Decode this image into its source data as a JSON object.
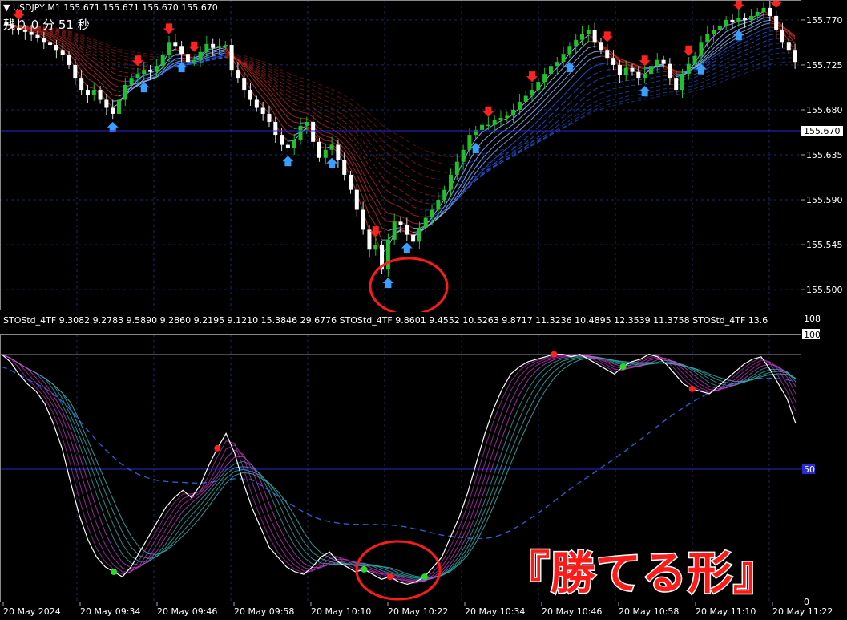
{
  "header": {
    "symbol_line": "USDJPY,M1  155.671 155.671 155.670 155.670",
    "countdown": "残り 0 分 51 秒",
    "indicator_line": "STOStd_4TF 9.3082 9.2783 9.5890 9.2860 9.2195 9.1210 15.3846 29.6776  STOStd_4TF 9.8601 9.4552 10.5263 9.8717 11.3236 10.4895 12.3539 11.3758  STOStd_4TF 13.6"
  },
  "price_axis": {
    "ticks": [
      "155.770",
      "155.725",
      "155.680",
      "155.635",
      "155.590",
      "155.545",
      "155.500"
    ],
    "current_price": "155.670"
  },
  "osc_axis": {
    "ticks": [
      "108",
      "100",
      "50",
      "0"
    ]
  },
  "time_axis": {
    "labels": [
      "20 May 2024",
      "20 May 09:34",
      "20 May 09:46",
      "20 May 09:58",
      "20 May 10:10",
      "20 May 10:22",
      "20 May 10:34",
      "20 May 10:46",
      "20 May 10:58",
      "20 May 11:10",
      "20 May 11:22"
    ]
  },
  "overlay": {
    "text": "『勝てる形』"
  },
  "colors": {
    "bull": "#22c02a",
    "bear": "#ffffff",
    "ribbon_bear": "#c0281e",
    "ribbon_bull": "#2a64ff",
    "signal_down": "#ff2020",
    "signal_up": "#3aa0ff",
    "stoch_pink": "#e040e0",
    "stoch_teal": "#30b0b0",
    "circle": "#ff1a1a"
  },
  "chart_data": [
    {
      "type": "candlestick",
      "title": "USDJPY,M1",
      "ylim": [
        155.48,
        155.79
      ],
      "close": [
        155.765,
        155.762,
        155.76,
        155.758,
        155.755,
        155.752,
        155.748,
        155.745,
        155.74,
        155.735,
        155.725,
        155.712,
        155.7,
        155.695,
        155.7,
        155.69,
        155.682,
        155.676,
        155.69,
        155.705,
        155.712,
        155.716,
        155.72,
        155.718,
        155.724,
        155.735,
        155.748,
        155.744,
        155.736,
        155.728,
        155.73,
        155.738,
        155.746,
        155.742,
        155.744,
        155.745,
        155.72,
        155.712,
        155.7,
        155.69,
        155.682,
        155.676,
        155.668,
        155.655,
        155.645,
        155.642,
        155.65,
        155.664,
        155.668,
        155.648,
        155.632,
        155.64,
        155.645,
        155.63,
        155.615,
        155.6,
        155.58,
        155.56,
        155.54,
        155.545,
        155.52,
        155.55,
        155.568,
        155.565,
        155.555,
        155.548,
        155.562,
        155.572,
        155.58,
        155.59,
        155.6,
        155.615,
        155.628,
        155.64,
        155.655,
        155.66,
        155.665,
        155.665,
        155.67,
        155.672,
        155.674,
        155.68,
        155.688,
        155.694,
        155.7,
        155.708,
        155.716,
        155.724,
        155.728,
        155.736,
        155.744,
        155.75,
        155.756,
        155.76,
        155.748,
        155.74,
        155.732,
        155.725,
        155.715,
        155.722,
        155.718,
        155.712,
        155.716,
        155.724,
        155.73,
        155.726,
        155.712,
        155.7,
        155.716,
        155.726,
        155.734,
        155.748,
        155.756,
        155.76,
        155.764,
        155.77,
        155.768,
        155.772,
        155.77,
        155.774,
        155.778,
        155.782,
        155.774,
        155.76,
        155.748,
        155.74,
        155.728
      ],
      "signals_down_at_index": [
        2,
        21,
        26,
        30,
        59,
        77,
        84,
        96,
        102,
        109,
        117,
        123
      ],
      "signals_up_at_index": [
        17,
        22,
        28,
        45,
        52,
        61,
        64,
        75,
        90,
        102,
        111,
        117
      ]
    },
    {
      "type": "line",
      "title": "STOStd_4TF",
      "ylim": [
        0,
        108
      ],
      "main_line": [
        100,
        97,
        92,
        88,
        85,
        80,
        72,
        62,
        48,
        35,
        25,
        18,
        14,
        12,
        10,
        14,
        20,
        26,
        32,
        38,
        42,
        45,
        42,
        47,
        55,
        62,
        68,
        60,
        48,
        38,
        30,
        22,
        18,
        14,
        12,
        11,
        14,
        18,
        20,
        16,
        14,
        12,
        13,
        11,
        9,
        10,
        8,
        7,
        8,
        10,
        14,
        18,
        26,
        34,
        44,
        56,
        68,
        78,
        86,
        92,
        95,
        97,
        98,
        99,
        100,
        100,
        99,
        100,
        98,
        96,
        94,
        92,
        95,
        97,
        98,
        100,
        99,
        96,
        92,
        88,
        86,
        85,
        84,
        87,
        90,
        93,
        96,
        98,
        99,
        94,
        88,
        82,
        72
      ],
      "markers": [
        {
          "series": "main_line",
          "index": 13,
          "kind": "buy"
        },
        {
          "series": "main_line",
          "index": 25,
          "kind": "sell"
        },
        {
          "series": "main_line",
          "index": 42,
          "kind": "buy"
        },
        {
          "series": "main_line",
          "index": 45,
          "kind": "sell"
        },
        {
          "series": "main_line",
          "index": 49,
          "kind": "buy"
        },
        {
          "series": "main_line",
          "index": 64,
          "kind": "sell"
        },
        {
          "series": "main_line",
          "index": 72,
          "kind": "buy"
        },
        {
          "series": "main_line",
          "index": 80,
          "kind": "sell"
        }
      ]
    }
  ]
}
